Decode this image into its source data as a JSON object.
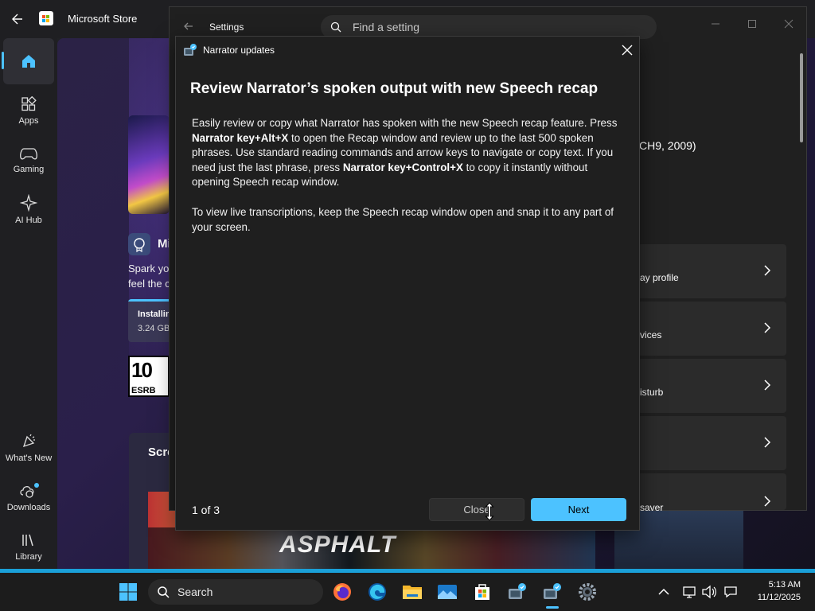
{
  "store": {
    "title": "Microsoft Store",
    "nav": [
      {
        "label": "Apps",
        "icon": "apps-icon"
      },
      {
        "label": "Gaming",
        "icon": "gamepad-icon"
      },
      {
        "label": "AI Hub",
        "icon": "ai-hub-icon"
      },
      {
        "label": "What's New",
        "icon": "whats-new-icon"
      },
      {
        "label": "Downloads",
        "icon": "downloads-icon"
      },
      {
        "label": "Library",
        "icon": "library-icon"
      }
    ],
    "home_icon": "home-icon",
    "game": {
      "title_partial": "Mi",
      "desc_line1": "Spark yo",
      "desc_line2": "feel the c",
      "install_status": "Installing",
      "install_size": "3.24 GB",
      "esrb_rating": "10",
      "esrb_label": "ESRB"
    },
    "screenshots_title": "Scre",
    "screenshot_logo": "ASPHALT"
  },
  "settings": {
    "title": "Settings",
    "search_placeholder": "Find a setting",
    "device_text_partial": "CH9, 2009)",
    "rows": [
      {
        "label": "ay profile"
      },
      {
        "label": "vices"
      },
      {
        "label": "isturb"
      },
      {
        "label": ""
      },
      {
        "label": "saver"
      }
    ]
  },
  "dialog": {
    "caption": "Narrator updates",
    "heading": "Review Narrator’s spoken output with new Speech recap",
    "para1_a": "Easily review or copy what Narrator has spoken with the new Speech recap feature. Press ",
    "para1_b": "Narrator key+Alt+X",
    "para1_c": " to open the Recap window and review up to the last 500 spoken phrases. Use standard reading commands and arrow keys to navigate or copy text. If you need just the last phrase, press ",
    "para1_d": "Narrator key+Control+X",
    "para1_e": " to copy it instantly without opening Speech recap window.",
    "para2": "To view live transcriptions, keep the Speech recap window open and snap it to any part of your screen.",
    "page_indicator": "1 of 3",
    "close_label": "Close",
    "next_label": "Next"
  },
  "taskbar": {
    "search_label": "Search",
    "apps": [
      "windows-start-icon",
      "firefox-icon",
      "edge-icon",
      "file-explorer-icon",
      "photos-icon",
      "microsoft-store-icon",
      "narrator-icon",
      "narrator-active-icon",
      "settings-gear-icon"
    ],
    "tray_time": "5:13 AM",
    "tray_date": "11/12/2025"
  },
  "colors": {
    "accent": "#4cc2ff",
    "dialog_bg": "#1f1f1f",
    "taskbar_accent": "#1aa0d8"
  }
}
